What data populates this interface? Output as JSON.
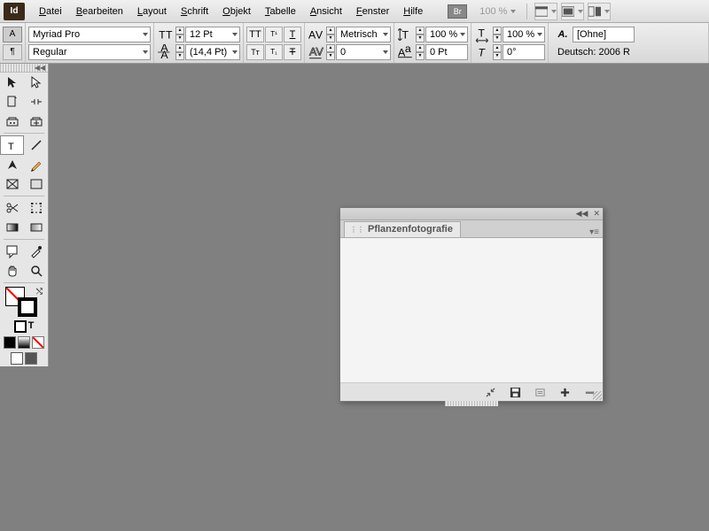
{
  "app": {
    "logo_text": "Id"
  },
  "menu": {
    "items": [
      "Datei",
      "Bearbeiten",
      "Layout",
      "Schrift",
      "Objekt",
      "Tabelle",
      "Ansicht",
      "Fenster",
      "Hilfe"
    ],
    "bridge_label": "Br",
    "zoom_label": "100 %"
  },
  "control": {
    "font_family": "Myriad Pro",
    "font_style": "Regular",
    "font_size": "12 Pt",
    "leading": "(14,4 Pt)",
    "kerning_mode": "Metrisch",
    "tracking": "0",
    "vscale": "100 %",
    "hscale": "100 %",
    "baseline_shift": "0 Pt",
    "skew": "0°",
    "char_style": "[Ohne]",
    "language": "Deutsch: 2006 R"
  },
  "panel": {
    "tab_label": "Pflanzenfotografie"
  }
}
